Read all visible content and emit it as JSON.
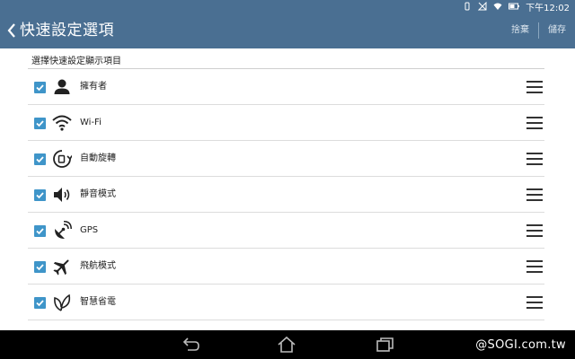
{
  "status_bar": {
    "time": "下午12:02",
    "icons": [
      "vibrate-icon",
      "no-signal-icon",
      "wifi-icon",
      "battery-icon"
    ]
  },
  "app_bar": {
    "title": "快速設定選項",
    "discard_label": "捨棄",
    "save_label": "儲存"
  },
  "section_title": "選擇快速設定顯示項目",
  "items": [
    {
      "label": "擁有者",
      "icon": "person-icon",
      "checked": true
    },
    {
      "label": "Wi-Fi",
      "icon": "wifi-icon",
      "checked": true
    },
    {
      "label": "自動旋轉",
      "icon": "auto-rotate-icon",
      "checked": true
    },
    {
      "label": "靜音模式",
      "icon": "speaker-icon",
      "checked": true
    },
    {
      "label": "GPS",
      "icon": "gps-icon",
      "checked": true
    },
    {
      "label": "飛航模式",
      "icon": "airplane-icon",
      "checked": true
    },
    {
      "label": "智慧省電",
      "icon": "leaf-icon",
      "checked": true
    }
  ],
  "nav_bar": {
    "watermark": "@SOGI.com.tw"
  },
  "colors": {
    "app_bar": "#4a6f92",
    "checkbox": "#3f95c9",
    "nav_bar": "#000000"
  }
}
